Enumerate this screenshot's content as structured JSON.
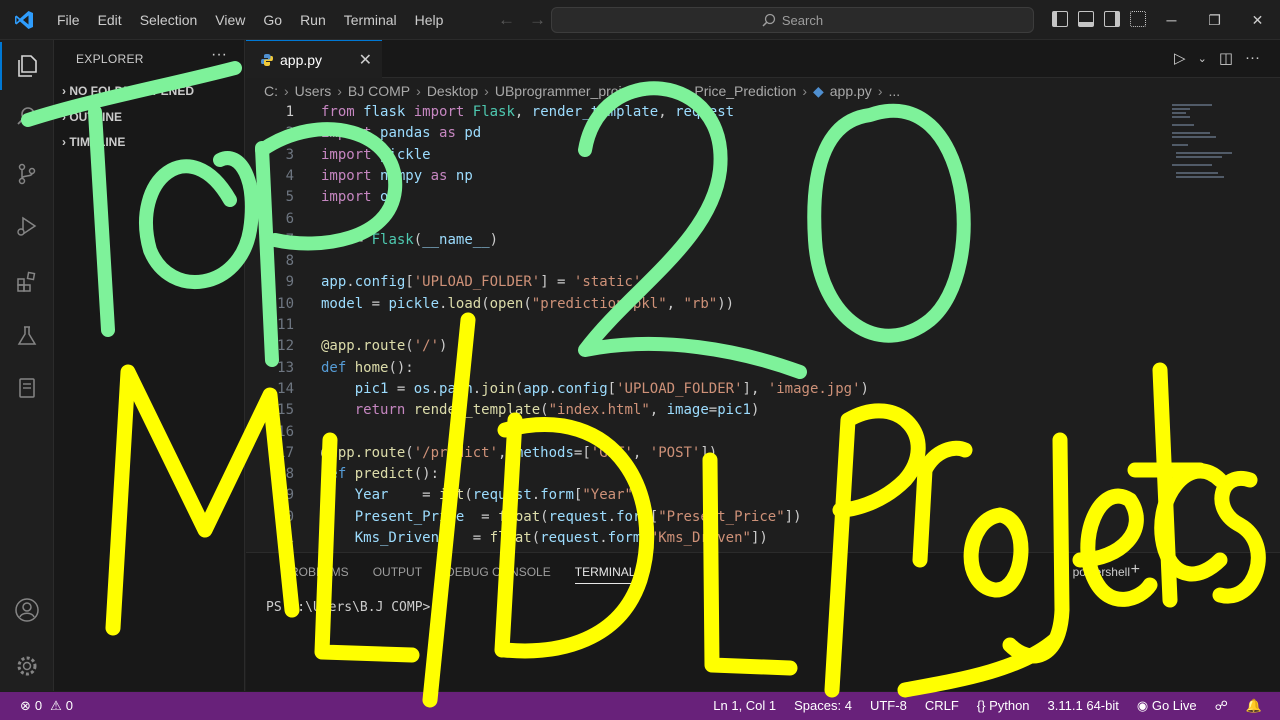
{
  "menu": [
    "File",
    "Edit",
    "Selection",
    "View",
    "Go",
    "Run",
    "Terminal",
    "Help"
  ],
  "search": {
    "label": "Search"
  },
  "sidebar": {
    "title": "EXPLORER",
    "sections": [
      "NO FOLDER OPENED",
      "OUTLINE",
      "TIMELINE"
    ]
  },
  "tab": {
    "label": "app.py"
  },
  "breadcrumb": [
    "C:",
    "Users",
    "BJ COMP",
    "Desktop",
    "UBprogrammer_projects",
    "Car_Price_Prediction",
    "app.py",
    "..."
  ],
  "code_lines": [
    "from flask import Flask, render_template, request",
    "import pandas as pd",
    "import pickle",
    "import numpy as np",
    "import os",
    "",
    "app = Flask(__name__)",
    "",
    "app.config['UPLOAD_FOLDER'] = 'static'",
    "model = pickle.load(open(\"prediction.pkl\", \"rb\"))",
    "",
    "@app.route('/')",
    "def home():",
    "    pic1 = os.path.join(app.config['UPLOAD_FOLDER'], 'image.jpg')",
    "    return render_template(\"index.html\", image=pic1)",
    "",
    "@app.route('/predict', methods=['GET', 'POST'])",
    "def predict():",
    "    Year    = int(request.form[\"Year\"])",
    "    Present_Price  = float(request.form[\"Present_Price\"])",
    "    Kms_Driven    = float(request.form[\"Kms_Driven\"])"
  ],
  "panel": {
    "tabs": [
      "PROBLEMS",
      "OUTPUT",
      "DEBUG CONSOLE",
      "TERMINAL"
    ],
    "shell": "powershell",
    "prompt": "PS C:\\Users\\B.J COMP>"
  },
  "status": {
    "errors": "0",
    "warnings": "0",
    "position": "Ln 1, Col 1",
    "spaces": "Spaces: 4",
    "encoding": "UTF-8",
    "eol": "CRLF",
    "language": "Python",
    "interpreter": "3.11.1 64-bit",
    "golive": "Go Live"
  },
  "overlay": {
    "line1": "Top 20",
    "line2": "ML/DL Projects"
  },
  "colors": {
    "statusbar": "#68217a",
    "overlay_green": "#7ef29a",
    "overlay_yellow": "#ffff00",
    "accent": "#0078d4"
  }
}
